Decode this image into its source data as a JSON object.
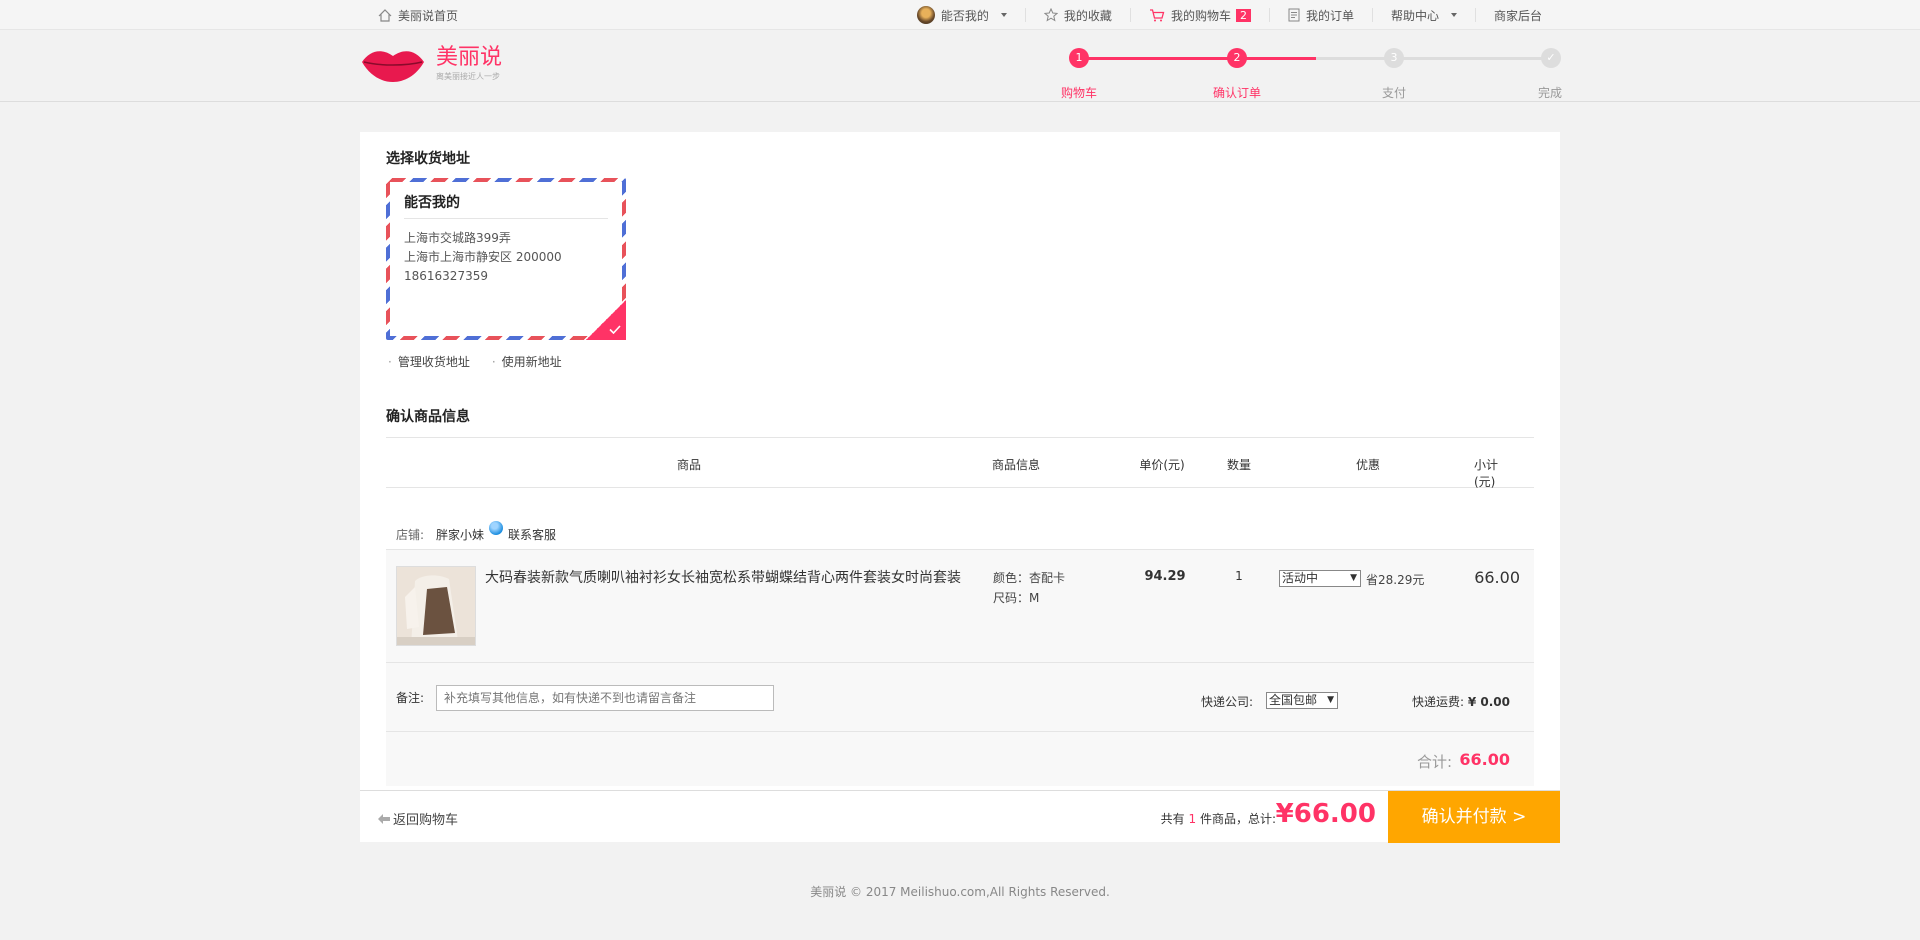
{
  "topbar": {
    "home_label": "美丽说首页",
    "user_label": "能否我的",
    "favorites_label": "我的收藏",
    "cart_label": "我的购物车",
    "cart_count": "2",
    "orders_label": "我的订单",
    "help_label": "帮助中心",
    "merchant_label": "商家后台"
  },
  "logo": {
    "title": "美丽说",
    "subtitle": "离美丽接近人一步"
  },
  "steps": [
    {
      "num": "1",
      "label": "购物车",
      "state": "done"
    },
    {
      "num": "2",
      "label": "确认订单",
      "state": "active"
    },
    {
      "num": "3",
      "label": "支付",
      "state": "todo"
    },
    {
      "num": "✓",
      "label": "完成",
      "state": "todo"
    }
  ],
  "address": {
    "section_title": "选择收货地址",
    "name": "能否我的",
    "line1": "上海市交城路399弄",
    "line2": "上海市上海市静安区 200000",
    "phone": "18616327359",
    "manage_link": "管理收货地址",
    "new_link": "使用新地址"
  },
  "goods": {
    "section_title": "确认商品信息",
    "headers": [
      "商品",
      "商品信息",
      "单价(元)",
      "数量",
      "优惠",
      "小计(元)"
    ],
    "shop_label": "店铺:",
    "shop_name": "胖家小妹",
    "contact_label": "联系客服",
    "item": {
      "title": "大码春装新款气质喇叭袖衬衫女长袖宽松系带蝴蝶结背心两件套装女时尚套装",
      "color": "颜色：杏配卡",
      "size": "尺码：M",
      "price": "94.29",
      "qty": "1",
      "promo": "活动中",
      "save": "省28.29元",
      "subtotal": "66.00"
    },
    "note_label": "备注:",
    "note_placeholder": "补充填写其他信息，如有快递不到也请留言备注",
    "ship_company_label": "快递公司:",
    "ship_company": "全国包邮",
    "ship_fee_label": "快递运费:",
    "ship_fee": "¥ 0.00",
    "total_label": "合计:",
    "total": "66.00"
  },
  "bottom": {
    "back_label": "返回购物车",
    "count_prefix": "共有",
    "count": "1",
    "count_suffix": "件商品，总计:",
    "grand_total": "¥66.00",
    "pay_label": "确认并付款 >"
  },
  "footer": {
    "copyright": "美丽说 © 2017 Meilishuo.com,All Rights Reserved."
  },
  "colors": {
    "accent": "#ff3366",
    "pay": "#ffa600",
    "step_inactive": "#dddddd"
  }
}
